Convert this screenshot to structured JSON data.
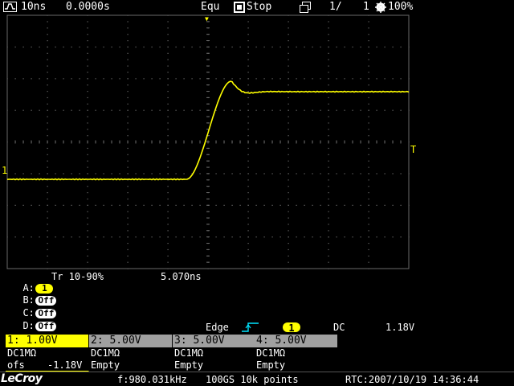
{
  "topbar": {
    "timebase": "10ns",
    "delay": "0.0000s",
    "acq_mode": "Equ",
    "run_state": "Stop",
    "page": "1/",
    "page_total": "1",
    "zoom": "100%"
  },
  "markers": {
    "ch1_ground": "1",
    "trigger_level": "T",
    "trigger_position": "▼"
  },
  "measurements": [
    {
      "key": "A:",
      "source": "1",
      "param": "Tr 10-90%",
      "value": "5.070ns"
    },
    {
      "key": "B:",
      "source": "Off",
      "param": "",
      "value": ""
    },
    {
      "key": "C:",
      "source": "Off",
      "param": "",
      "value": ""
    },
    {
      "key": "D:",
      "source": "Off",
      "param": "",
      "value": ""
    }
  ],
  "trigger": {
    "type": "Edge",
    "slope_icon": "rising-edge-icon",
    "source": "1",
    "coupling": "DC",
    "level": "1.18V"
  },
  "channels": [
    {
      "head": "1: 1.00V",
      "coupling": "DC1MΩ",
      "line2_label": "ofs",
      "line2_value": "-1.18V",
      "active": true
    },
    {
      "head": "2: 5.00V",
      "coupling": "DC1MΩ",
      "line2_label": "Empty",
      "line2_value": "",
      "active": false
    },
    {
      "head": "3: 5.00V",
      "coupling": "DC1MΩ",
      "line2_label": "Empty",
      "line2_value": "",
      "active": false
    },
    {
      "head": "4: 5.00V",
      "coupling": "DC1MΩ",
      "line2_label": "Empty",
      "line2_value": "",
      "active": false
    }
  ],
  "bottombar": {
    "brand": "LeCroy",
    "frequency": "f:980.031kHz",
    "sample": "100GS 10k points",
    "rtc": "RTC:2007/10/19 14:36:44"
  },
  "colors": {
    "trace": "#ffff00",
    "grid": "#6a6a6a",
    "inactive_channel": "#a0a0a0"
  },
  "icons": {
    "waveform": "waveform-icon",
    "stop": "stop-icon",
    "layout": "layout-icon",
    "zoom": "zoom-icon"
  }
}
